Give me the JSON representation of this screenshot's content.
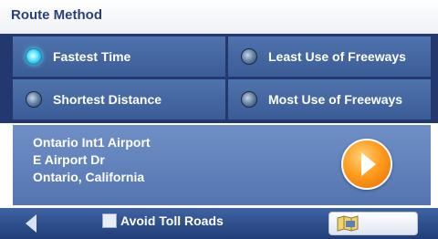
{
  "screen": {
    "title": "Route Method"
  },
  "route_options": [
    {
      "label": "Fastest Time",
      "selected": true
    },
    {
      "label": "Least Use of Freeways",
      "selected": false
    },
    {
      "label": "Shortest Distance",
      "selected": false
    },
    {
      "label": "Most Use of Freeways",
      "selected": false
    }
  ],
  "destination": {
    "line1": "Ontario Int1 Airport",
    "line2": "E Airport Dr",
    "line3": "Ontario, California"
  },
  "bottom_bar": {
    "avoid_toll_label": "Avoid Toll Roads",
    "avoid_toll_checked": false
  },
  "icons": {
    "go": "play-arrow-icon",
    "back": "back-arrow-icon",
    "map": "map-icon"
  },
  "colors": {
    "selected_radio": "#5fe6ff",
    "go_button": "#ff9d1f",
    "panel_blue": "#4f73ac"
  }
}
